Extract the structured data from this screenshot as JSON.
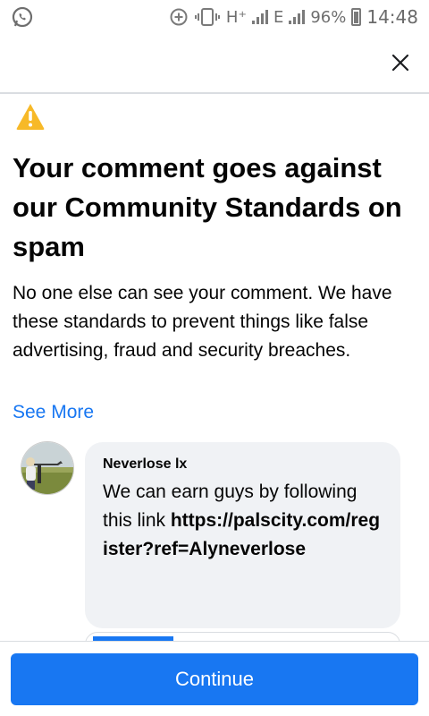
{
  "status_bar": {
    "network_1": "H⁺",
    "network_2": "E",
    "battery": "96%",
    "time": "14:48",
    "icons": [
      "whatsapp-icon",
      "data-saver-icon",
      "vibrate-icon",
      "signal-icon",
      "battery-charging-icon"
    ]
  },
  "header": {
    "close_icon": "close-icon"
  },
  "notice": {
    "icon": "warning-icon",
    "title": "Your comment goes against our Community Standards on spam",
    "description": "No one else can see your comment. We have these standards to prevent things like false advertising, fraud and security breaches.",
    "see_more": "See More"
  },
  "comment": {
    "author": "Neverlose lx",
    "text_plain": "We can earn guys by following this link ",
    "text_link": "https://palscity.com/register?ref=Alyneverlose"
  },
  "footer": {
    "continue_label": "Continue"
  },
  "colors": {
    "accent": "#1877f2",
    "bubble": "#f0f2f5",
    "warning": "#f7b928",
    "text": "#050505"
  }
}
